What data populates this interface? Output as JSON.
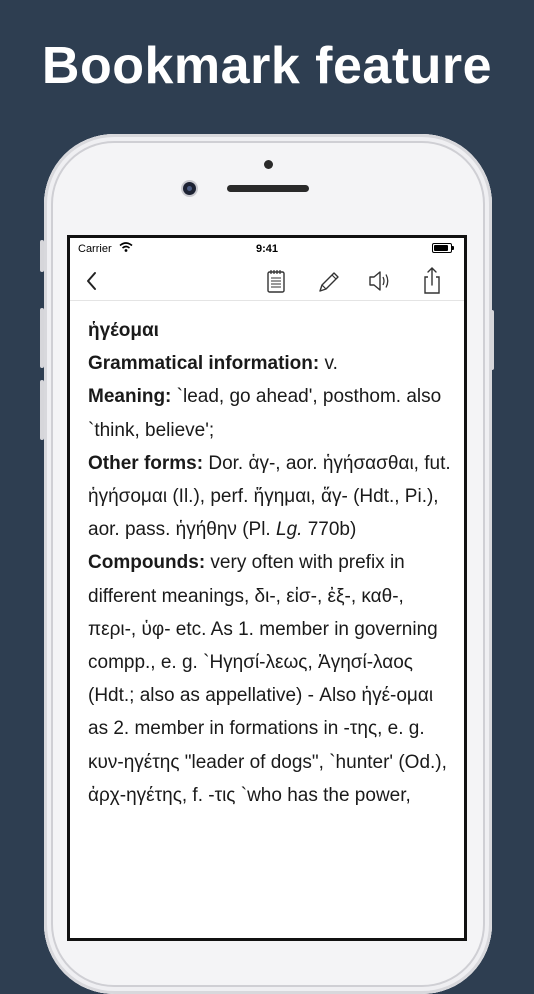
{
  "headline": "Bookmark feature",
  "status_bar": {
    "carrier": "Carrier",
    "time": "9:41"
  },
  "toolbar": {
    "back": "chevron-left-icon",
    "icons": [
      "notes-icon",
      "pencil-icon",
      "speaker-icon",
      "share-icon"
    ]
  },
  "entry": {
    "headword": "ἡγέομαι",
    "grammar_label": "Grammatical information:",
    "grammar_value": " v.",
    "meaning_label": "Meaning:",
    "meaning_value": " `lead, go ahead', posthom. also `think, believe';",
    "other_forms_label": "Other forms:",
    "other_forms_value": " Dor. ἁγ-, aor. ἡγήσασθαι, fut. ἡγήσομαι (Il.), perf. ἥγημαι, ἅγ- (Hdt., Pi.), aor. pass. ἡγήθην (Pl. ",
    "other_forms_italic": "Lg.",
    "other_forms_end": " 770b)",
    "compounds_label": "Compounds:",
    "compounds_value": " very often with prefix in different meanings, δι-, εἰσ-, ἐξ-, καθ-, περι-, ὑφ- etc. As 1. member in governing compp., e. g. `Ηγησί-λεως, Ἁγησί-λαος (Hdt.; also as appellative) - Also ἡγέ-ομαι as 2. member in formations in -της, e. g. κυν-ηγέτης \"leader of dogs\", `hunter' (Od.), ἀρχ-ηγέτης, f. -τις `who has the power,"
  },
  "colors": {
    "background": "#2e3e51",
    "phone": "#f4f4f6",
    "text": "#1a1a1a"
  }
}
